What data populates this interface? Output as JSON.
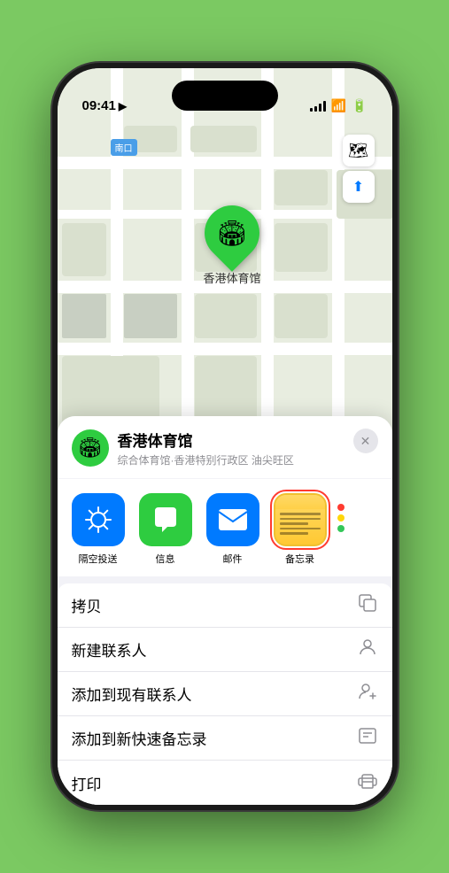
{
  "status": {
    "time": "09:41",
    "location_arrow": "▶"
  },
  "map": {
    "label": "南口",
    "buttons": {
      "map_icon": "🗺",
      "location_icon": "⬆"
    }
  },
  "pin": {
    "name": "香港体育馆",
    "emoji": "🏟"
  },
  "location_header": {
    "name": "香港体育馆",
    "description": "综合体育馆·香港特别行政区 油尖旺区",
    "close": "×"
  },
  "share_apps": [
    {
      "id": "airdrop",
      "label": "隔空投送"
    },
    {
      "id": "messages",
      "label": "信息"
    },
    {
      "id": "mail",
      "label": "邮件"
    },
    {
      "id": "notes",
      "label": "备忘录",
      "selected": true
    }
  ],
  "action_items": [
    {
      "label": "拷贝",
      "icon": "copy"
    },
    {
      "label": "新建联系人",
      "icon": "person"
    },
    {
      "label": "添加到现有联系人",
      "icon": "person-add"
    },
    {
      "label": "添加到新快速备忘录",
      "icon": "note"
    },
    {
      "label": "打印",
      "icon": "print"
    }
  ]
}
